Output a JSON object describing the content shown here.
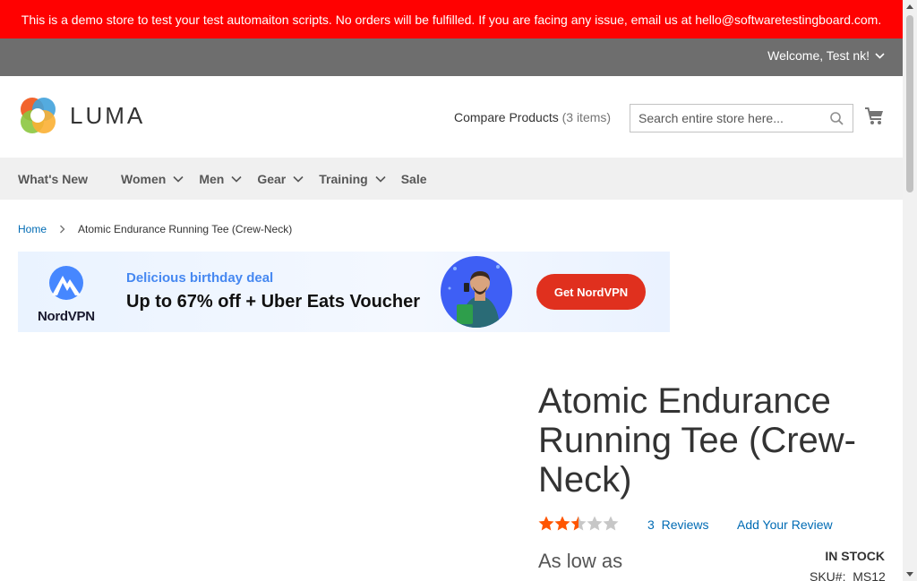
{
  "demo_notice": "This is a demo store to test your test automaiton scripts. No orders will be fulfilled. If you are facing any issue, email us at hello@softwaretestingboard.com.",
  "topbar": {
    "welcome": "Welcome, Test nk!"
  },
  "header": {
    "logo_text": "LUMA",
    "compare_label": "Compare Products",
    "compare_count": "(3 items)",
    "search_placeholder": "Search entire store here...",
    "cart_icon": "cart-icon"
  },
  "nav": {
    "items": [
      {
        "label": "What's New",
        "has_dropdown": false
      },
      {
        "label": "Women",
        "has_dropdown": true
      },
      {
        "label": "Men",
        "has_dropdown": true
      },
      {
        "label": "Gear",
        "has_dropdown": true
      },
      {
        "label": "Training",
        "has_dropdown": true
      },
      {
        "label": "Sale",
        "has_dropdown": false
      }
    ]
  },
  "breadcrumb": {
    "home": "Home",
    "current": "Atomic Endurance Running Tee (Crew-Neck)"
  },
  "ad": {
    "brand": "NordVPN",
    "tagline": "Delicious birthday deal",
    "headline": "Up to 67% off + Uber Eats Voucher",
    "cta": "Get NordVPN"
  },
  "product": {
    "title": "Atomic Endurance Running Tee (Crew-Neck)",
    "rating": 2.5,
    "rating_max": 5,
    "reviews_count": "3",
    "reviews_label": "Reviews",
    "add_review": "Add Your Review",
    "stock": "IN STOCK",
    "price_prefix": "As low as",
    "sku_label": "SKU#:",
    "sku_value": "MS12"
  },
  "colors": {
    "demo_banner": "#ff0101",
    "topbar": "#6e6e6e",
    "nav_bg": "#f0f0f0",
    "link": "#006bb4",
    "star": "#ff5501",
    "ad_cta": "#e0301e"
  }
}
